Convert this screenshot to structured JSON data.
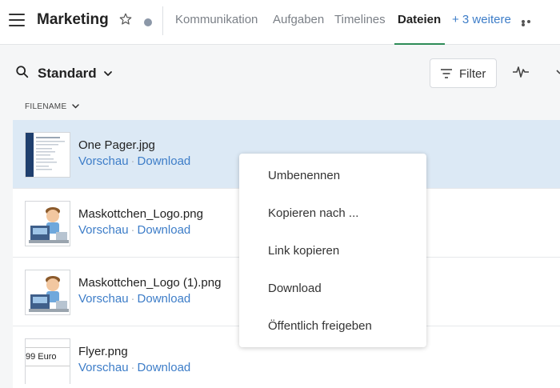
{
  "header": {
    "title": "Marketing",
    "tabs": [
      {
        "label": "Kommunikation"
      },
      {
        "label": "Aufgaben"
      },
      {
        "label": "Timelines"
      },
      {
        "label": "Dateien",
        "active": true
      }
    ],
    "more_label": "+ 3 weitere"
  },
  "toolbar": {
    "view_name": "Standard",
    "filter_label": "Filter"
  },
  "column": {
    "label": "FILENAME"
  },
  "files": [
    {
      "name": "One Pager.jpg",
      "preview": "Vorschau",
      "sep": "·",
      "download": "Download",
      "selected": true,
      "thumb": "document-thumbnail"
    },
    {
      "name": "Maskottchen_Logo.png",
      "preview": "Vorschau",
      "sep": "·",
      "download": "Download",
      "thumb": "mascot-thumbnail"
    },
    {
      "name": "Maskottchen_Logo (1).png",
      "preview": "Vorschau",
      "sep": "·",
      "download": "Download",
      "thumb": "mascot-thumbnail"
    },
    {
      "name": "Flyer.png",
      "preview": "Vorschau",
      "sep": "·",
      "download": "Download",
      "thumb": "flyer-thumbnail",
      "thumb_text": "99 Euro"
    }
  ],
  "context_menu": {
    "items": [
      {
        "label": "Umbenennen"
      },
      {
        "label": "Kopieren nach ..."
      },
      {
        "label": "Link kopieren"
      },
      {
        "label": "Download"
      },
      {
        "label": "Öffentlich freigeben"
      }
    ]
  },
  "colors": {
    "accent_link": "#3d7dc8",
    "active_tab_underline": "#2e8b57",
    "selected_row": "#dce9f5"
  }
}
